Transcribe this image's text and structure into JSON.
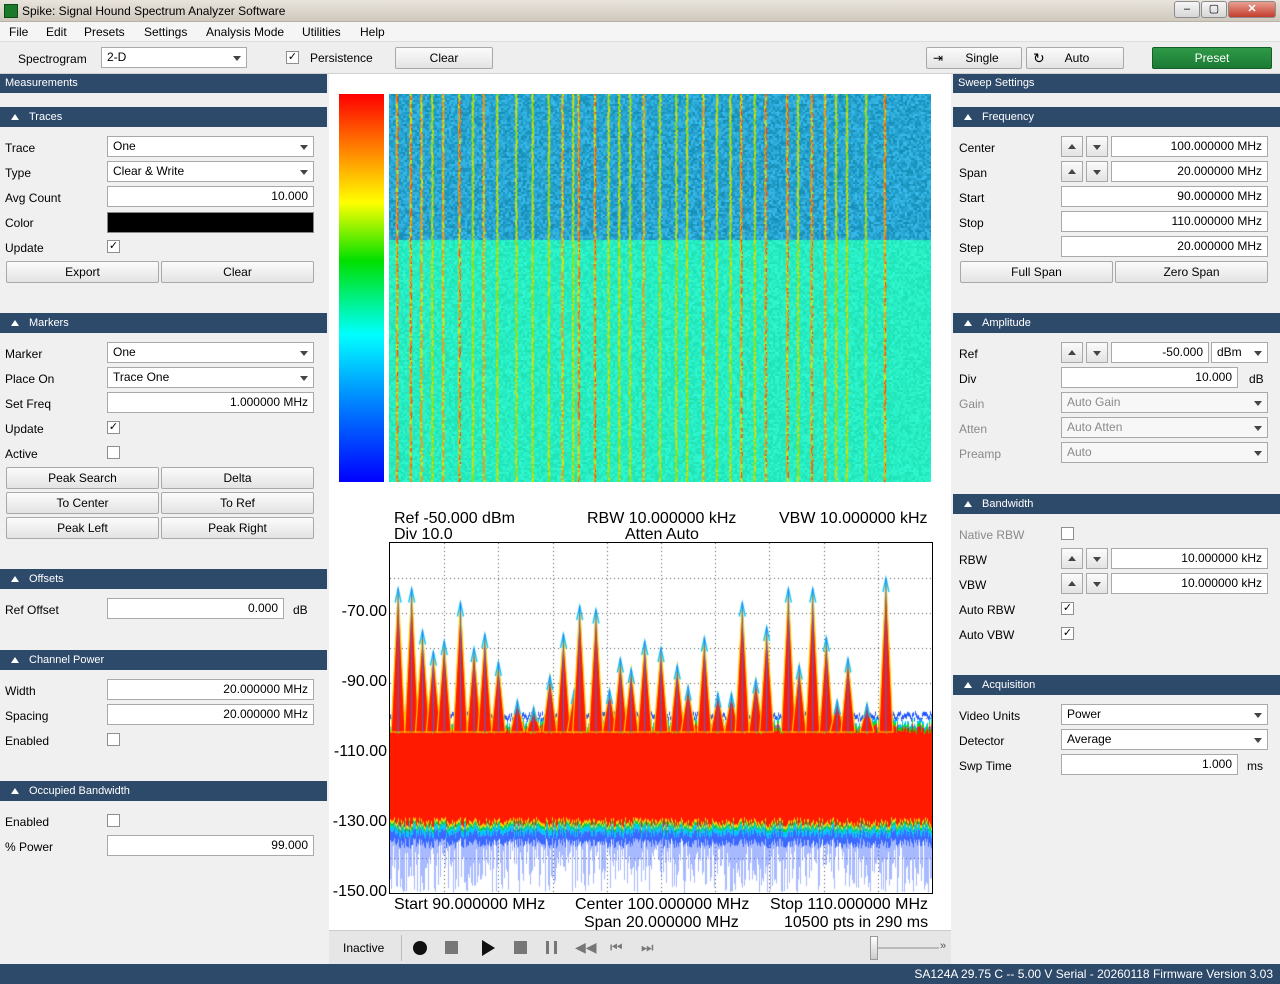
{
  "window": {
    "title": "Spike: Signal Hound Spectrum Analyzer Software"
  },
  "menu": [
    "File",
    "Edit",
    "Presets",
    "Settings",
    "Analysis Mode",
    "Utilities",
    "Help"
  ],
  "toolbar": {
    "spectrogram_label": "Spectrogram",
    "spectrogram_mode": "2-D",
    "persistence_label": "Persistence",
    "persistence_checked": "✓",
    "clear_label": "Clear",
    "single_label": "Single",
    "auto_label": "Auto",
    "preset_label": "Preset"
  },
  "left": {
    "dock_title": "Measurements",
    "traces": {
      "title": "Traces",
      "trace_label": "Trace",
      "trace_value": "One",
      "type_label": "Type",
      "type_value": "Clear & Write",
      "avg_label": "Avg Count",
      "avg_value": "10.000",
      "color_label": "Color",
      "color_value": "#000000",
      "update_label": "Update",
      "update_checked": "✓",
      "export_label": "Export",
      "clear_label": "Clear"
    },
    "markers": {
      "title": "Markers",
      "marker_label": "Marker",
      "marker_value": "One",
      "placeon_label": "Place On",
      "placeon_value": "Trace One",
      "setfreq_label": "Set Freq",
      "setfreq_value": "1.000000 MHz",
      "update_label": "Update",
      "update_checked": "✓",
      "active_label": "Active",
      "peak_search": "Peak Search",
      "delta": "Delta",
      "to_center": "To Center",
      "to_ref": "To Ref",
      "peak_left": "Peak Left",
      "peak_right": "Peak Right"
    },
    "offsets": {
      "title": "Offsets",
      "ref_label": "Ref Offset",
      "ref_value": "0.000",
      "unit": "dB"
    },
    "channel_power": {
      "title": "Channel Power",
      "width_label": "Width",
      "width_value": "20.000000 MHz",
      "spacing_label": "Spacing",
      "spacing_value": "20.000000 MHz",
      "enabled_label": "Enabled"
    },
    "occupied_bw": {
      "title": "Occupied Bandwidth",
      "enabled_label": "Enabled",
      "power_label": "% Power",
      "power_value": "99.000"
    }
  },
  "right": {
    "dock_title": "Sweep Settings",
    "frequency": {
      "title": "Frequency",
      "center_label": "Center",
      "center_value": "100.000000 MHz",
      "span_label": "Span",
      "span_value": "20.000000 MHz",
      "start_label": "Start",
      "start_value": "90.000000 MHz",
      "stop_label": "Stop",
      "stop_value": "110.000000 MHz",
      "step_label": "Step",
      "step_value": "20.000000 MHz",
      "full_span": "Full Span",
      "zero_span": "Zero Span"
    },
    "amplitude": {
      "title": "Amplitude",
      "ref_label": "Ref",
      "ref_value": "-50.000",
      "ref_unit": "dBm",
      "div_label": "Div",
      "div_value": "10.000",
      "div_unit": "dB",
      "gain_label": "Gain",
      "gain_value": "Auto Gain",
      "atten_label": "Atten",
      "atten_value": "Auto Atten",
      "preamp_label": "Preamp",
      "preamp_value": "Auto"
    },
    "bandwidth": {
      "title": "Bandwidth",
      "native_label": "Native RBW",
      "rbw_label": "RBW",
      "rbw_value": "10.000000 kHz",
      "vbw_label": "VBW",
      "vbw_value": "10.000000 kHz",
      "autorbw_label": "Auto RBW",
      "autorbw_checked": "✓",
      "autovbw_label": "Auto VBW",
      "autovbw_checked": "✓"
    },
    "acquisition": {
      "title": "Acquisition",
      "video_label": "Video Units",
      "video_value": "Power",
      "detector_label": "Detector",
      "detector_value": "Average",
      "swp_label": "Swp Time",
      "swp_value": "1.000",
      "swp_unit": "ms"
    }
  },
  "plot": {
    "ref_text": "Ref -50.000 dBm",
    "div_text": "Div 10.0",
    "rbw_text": "RBW 10.000000 kHz",
    "atten_text": "Atten Auto",
    "vbw_text": "VBW 10.000000 kHz",
    "start_text": "Start 90.000000 MHz",
    "center_text": "Center 100.000000 MHz",
    "span_text": "Span 20.000000 MHz",
    "stop_text": "Stop 110.000000 MHz",
    "pts_text": "10500 pts in 290 ms",
    "yticks": [
      "-70.00",
      "-90.00",
      "-110.00",
      "-130.00",
      "-150.00"
    ]
  },
  "chart_data": {
    "type": "line",
    "x_range_mhz": [
      90,
      110
    ],
    "ylim": [
      -150,
      -50
    ],
    "y_ticks": [
      -70,
      -90,
      -110,
      -130,
      -150
    ],
    "noise_floor_dbm": -112,
    "peaks": [
      {
        "x": 90.3,
        "y": -63
      },
      {
        "x": 90.8,
        "y": -63
      },
      {
        "x": 91.2,
        "y": -75
      },
      {
        "x": 91.6,
        "y": -81
      },
      {
        "x": 92.0,
        "y": -78
      },
      {
        "x": 92.6,
        "y": -67
      },
      {
        "x": 93.1,
        "y": -80
      },
      {
        "x": 93.5,
        "y": -76
      },
      {
        "x": 94.0,
        "y": -84
      },
      {
        "x": 94.7,
        "y": -95
      },
      {
        "x": 95.3,
        "y": -97
      },
      {
        "x": 95.9,
        "y": -88
      },
      {
        "x": 96.4,
        "y": -76
      },
      {
        "x": 96.8,
        "y": -92
      },
      {
        "x": 97.0,
        "y": -68
      },
      {
        "x": 97.6,
        "y": -69
      },
      {
        "x": 98.1,
        "y": -92
      },
      {
        "x": 98.5,
        "y": -83
      },
      {
        "x": 98.9,
        "y": -86
      },
      {
        "x": 99.4,
        "y": -78
      },
      {
        "x": 100.0,
        "y": -80
      },
      {
        "x": 100.6,
        "y": -85
      },
      {
        "x": 101.0,
        "y": -91
      },
      {
        "x": 101.6,
        "y": -77
      },
      {
        "x": 102.1,
        "y": -93
      },
      {
        "x": 102.6,
        "y": -93
      },
      {
        "x": 103.0,
        "y": -67
      },
      {
        "x": 103.5,
        "y": -89
      },
      {
        "x": 103.9,
        "y": -74
      },
      {
        "x": 104.7,
        "y": -63
      },
      {
        "x": 105.1,
        "y": -85
      },
      {
        "x": 105.6,
        "y": -63
      },
      {
        "x": 106.1,
        "y": -77
      },
      {
        "x": 106.5,
        "y": -95
      },
      {
        "x": 106.9,
        "y": -83
      },
      {
        "x": 107.6,
        "y": -96
      },
      {
        "x": 108.3,
        "y": -60
      }
    ]
  },
  "playback": {
    "state": "Inactive"
  },
  "status": {
    "text": "SA124A   29.75 C  --  5.00 V  Serial - 20260118   Firmware Version 3.03"
  }
}
